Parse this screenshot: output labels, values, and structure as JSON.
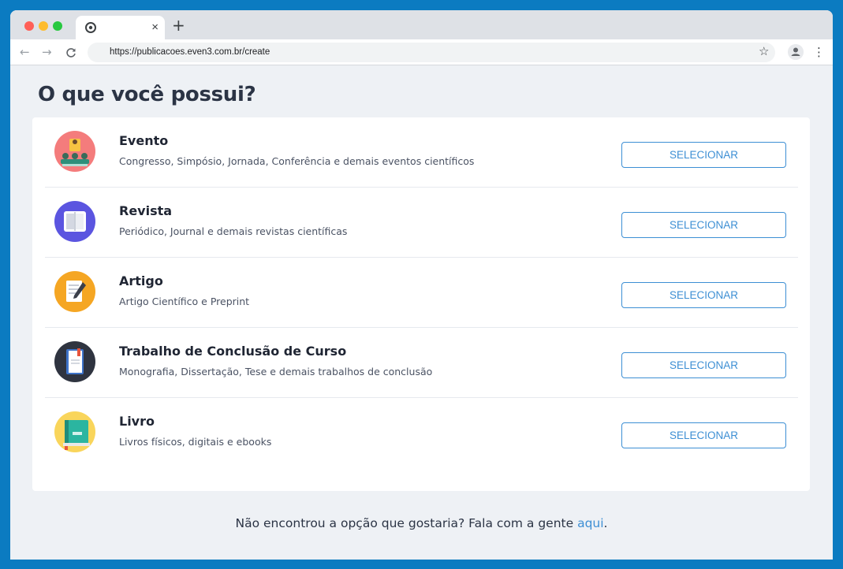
{
  "browser": {
    "url": "https://publicacoes.even3.com.br/create",
    "tab_close": "×",
    "new_tab": "+"
  },
  "page": {
    "title": "O que você possui?"
  },
  "options": [
    {
      "title": "Evento",
      "description": "Congresso, Simpósio, Jornada, Conferência e demais eventos científicos",
      "button": "SELECIONAR",
      "icon": "event-icon"
    },
    {
      "title": "Revista",
      "description": "Periódico, Journal e demais revistas científicas",
      "button": "SELECIONAR",
      "icon": "journal-icon"
    },
    {
      "title": "Artigo",
      "description": "Artigo Científico e Preprint",
      "button": "SELECIONAR",
      "icon": "article-icon"
    },
    {
      "title": "Trabalho de Conclusão de Curso",
      "description": "Monografia, Dissertação, Tese e demais trabalhos de conclusão",
      "button": "SELECIONAR",
      "icon": "thesis-icon"
    },
    {
      "title": "Livro",
      "description": "Livros físicos, digitais e ebooks",
      "button": "SELECIONAR",
      "icon": "book-icon"
    }
  ],
  "footer": {
    "text": "Não encontrou a opção que gostaria? Fala com a gente ",
    "link": "aqui",
    "suffix": "."
  },
  "colors": {
    "accent": "#3d8fd4",
    "background": "#0b7bc1"
  }
}
